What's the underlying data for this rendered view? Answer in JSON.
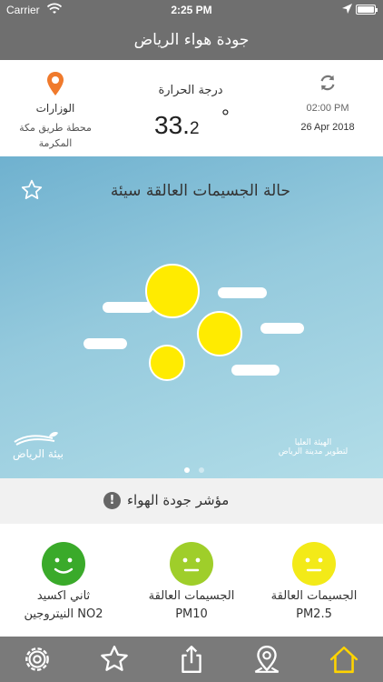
{
  "status_bar": {
    "carrier": "Carrier",
    "time": "2:25 PM"
  },
  "nav": {
    "title": "جودة هواء الرياض"
  },
  "info": {
    "time": "02:00 PM",
    "date": "26 Apr 2018",
    "temperature_label": "درجة الحرارة",
    "temperature_int": "33.",
    "temperature_dec": "2",
    "temperature_unit": "°",
    "station_label": "الوزارات",
    "station_name": "محطة طريق مكة المكرمة"
  },
  "hero": {
    "status_title": "حالة الجسيمات العالقة سيئة",
    "logo_left": "بيئة الرياض",
    "logo_right_line1": "الهيئة العليا",
    "logo_right_line2": "لتطوير مدينة الرياض"
  },
  "aqi": {
    "title": "مؤشر جودة الهواء",
    "info_glyph": "!",
    "pollutants": [
      {
        "name_line1": "الجسيمات العالقة",
        "name_line2": "PM2.5",
        "color": "#f3ea18",
        "mood": "neutral"
      },
      {
        "name_line1": "الجسيمات العالقة",
        "name_line2": "PM10",
        "color": "#9fce2a",
        "mood": "neutral"
      },
      {
        "name_line1": "ثاني اكسيد",
        "name_line2": "النيتروجين NO2",
        "color": "#3aaa2a",
        "mood": "happy"
      }
    ]
  },
  "tabbar": {
    "items": [
      "settings-icon",
      "star-icon",
      "share-icon",
      "map-pin-icon",
      "home-icon"
    ],
    "active": "home-icon",
    "active_color": "#ffd400"
  },
  "colors": {
    "nav": "#6f6f6f",
    "tabbar": "#7a7a7a",
    "sun": "#ffeb00",
    "accent_pin": "#f07a2c"
  }
}
